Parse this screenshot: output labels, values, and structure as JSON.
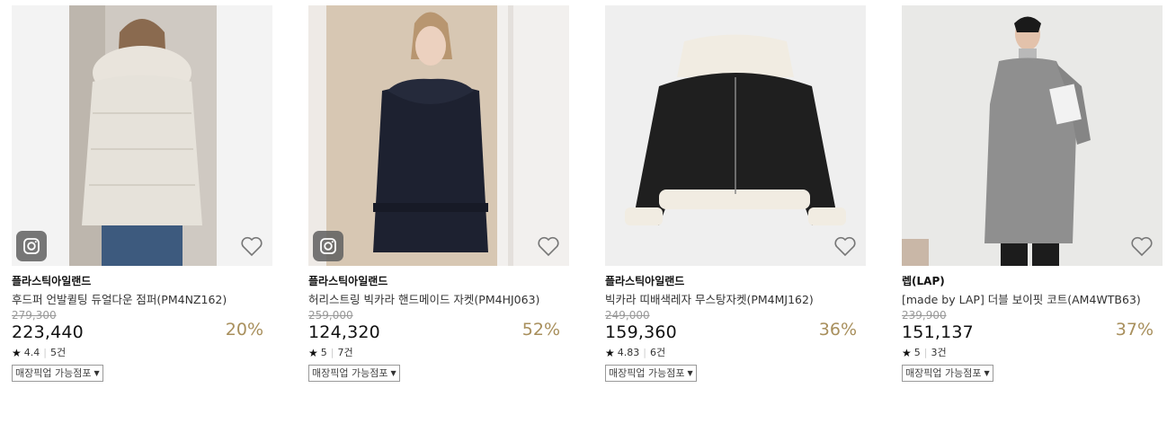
{
  "products": [
    {
      "brand": "플라스틱아일랜드",
      "name": "후드퍼 언발퀼팅 듀얼다운 점퍼(PM4NZ162)",
      "original_price": "279,300",
      "price": "223,440",
      "discount": "20%",
      "rating": "4.4",
      "reviews": "5건",
      "pickup_label": "매장픽업 가능점포",
      "has_instagram": true
    },
    {
      "brand": "플라스틱아일랜드",
      "name": "허리스트링 빅카라 핸드메이드 자켓(PM4HJ063)",
      "original_price": "259,000",
      "price": "124,320",
      "discount": "52%",
      "rating": "5",
      "reviews": "7건",
      "pickup_label": "매장픽업 가능점포",
      "has_instagram": true
    },
    {
      "brand": "플라스틱아일랜드",
      "name": "빅카라 띠배색레자 무스탕자켓(PM4MJ162)",
      "original_price": "249,000",
      "price": "159,360",
      "discount": "36%",
      "rating": "4.83",
      "reviews": "6건",
      "pickup_label": "매장픽업 가능점포",
      "has_instagram": false
    },
    {
      "brand": "렙(LAP)",
      "name": "[made by LAP] 더블 보이핏 코트(AM4WTB63)",
      "original_price": "239,900",
      "price": "151,137",
      "discount": "37%",
      "rating": "5",
      "reviews": "3건",
      "pickup_label": "매장픽업 가능점포",
      "has_instagram": false
    }
  ],
  "colors": {
    "discount": "#a88f5c",
    "strike": "#999999"
  },
  "icons": {
    "instagram": "instagram-icon",
    "wishlist": "heart-outline-icon",
    "rating": "star-icon",
    "dropdown": "caret-down-icon"
  }
}
